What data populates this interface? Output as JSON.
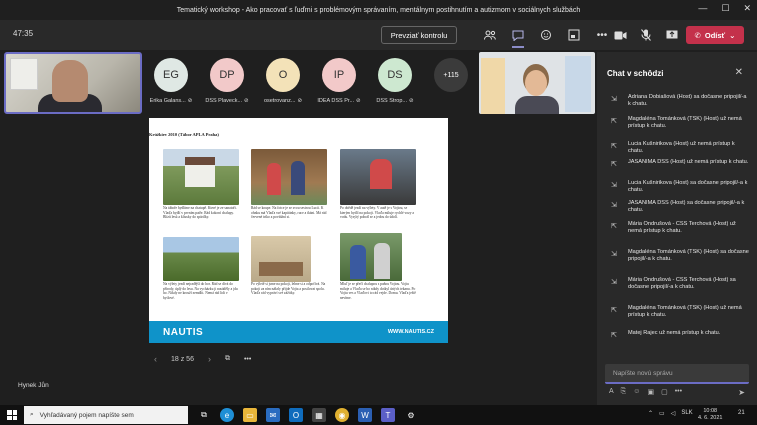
{
  "window": {
    "title": "Tematický workshop - Ako pracovať s ľuďmi s problémovým správaním, mentálnym postihnutím a autizmom v sociálnych službách"
  },
  "toolbar": {
    "timer": "47:35",
    "present_label": "Prevziať kontrolu",
    "leave_label": "Odísť"
  },
  "participants": [
    {
      "initials": "EG",
      "name": "Erika Galans...",
      "color": "#dfe8e4"
    },
    {
      "initials": "DP",
      "name": "DSS Plaveck...",
      "color": "#f2c9c9"
    },
    {
      "initials": "O",
      "name": "osetrovanz...",
      "color": "#f3e2b8"
    },
    {
      "initials": "IP",
      "name": "IDEA DSS Pr...",
      "color": "#f2c9c9"
    },
    {
      "initials": "DS",
      "name": "DSS Strop...",
      "color": "#cde8d0"
    }
  ],
  "more_participants": "+115",
  "document": {
    "heading": "Krúžkiev 2010 (Tábor APLA Praha)",
    "captions": [
      "Na táboře bydlíme na chatupě. Které je ze sanatoři. Vlaďa bydlí v prvním patře. Rád kokoní chalupy. Blízů lesů a kliusky do spárilky.",
      "Rád se koupe. Na fotce je se svou sestrou Lucii. K ohnku má Vlaďa své kapitánky, ruce a tkáni. Má rád červené triko a povídání si.",
      "Po obědě jezdí na výlety. V autě je s Vojtou, se kterým bydlí na pokoji. Vlaďa miluje rychlé vozy a vodu. Vysýtý pohrál se a jedou do údolí.",
      "Na výlety jezdí nejradější do hor. Rád se dívá do přírody, úplý do lesu. Na vycházku ji nasáděly a jdu ho. Nikdy ne krouží zemdlit. Nemá rád lidi v bytlové.",
      "Po výletě si jsme na pokoji, lehne si a odpočívá. Na pokoji za ním nákrly přijde Vojta a posilovat spolu. Vlaďa rád vypráví své zážitky.",
      "Mluľ je se přečí chalupou s paňou Vojtou. Vojtu miluje a Vlaďa se bo nikdy dotkyl úrtých tekanu. Po Vojtu ves a Vlaďovi to rád vejde. Domu. Vlaďa ještě nevíme."
    ],
    "logo": "NAUTIS",
    "url": "WWW.NAUTIS.CZ"
  },
  "pager": {
    "page_label": "18 z 56"
  },
  "name_tag": "Hynek Jůn",
  "chat": {
    "title": "Chat v schôdzi",
    "messages": [
      "Adriana Dobiašová (Host) sa dočasne pripojil/-a k chatu.",
      "Magdaléna Tománková (TSK) (Host) už nemá prístup k chatu.",
      "Lucia Kušnirikova (Host) už nemá prístup k chatu.",
      "JASANIMA DSS (Host) už nemá prístup k chatu.",
      "Lucia Kušnirikova (Host) sa dočasne pripojil/-a k chatu.",
      "JASANIMA DSS (Host) sa dočasne pripojil/-a k chatu.",
      "Mária Ondrušová - CSS Terchová (Host) už nemá prístup k chatu.",
      "Magdaléna Tománková (TSK) (Host) sa dočasne pripojil/-a k chatu.",
      "Mária Ondrušová - CSS Terchová (Host) sa dočasne pripojil/-a k chatu.",
      "Magdaléna Tománková (TSK) (Host) už nemá prístup k chatu.",
      "Matej Rajec už nemá prístup k chatu."
    ],
    "input_placeholder": "Napíšte novú správu"
  },
  "taskbar": {
    "search_placeholder": "Vyhľadávaný pojem napíšte sem",
    "language": "SLK",
    "time": "10:08",
    "date": "4. 6. 2021",
    "notifications": "21"
  }
}
